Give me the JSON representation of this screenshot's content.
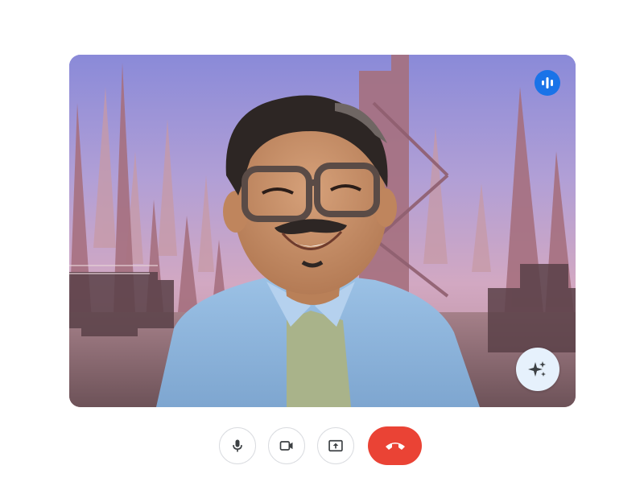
{
  "call": {
    "participant": {
      "video": "participant-video",
      "speaking": true
    },
    "effects_button": {
      "icon": "sparkle-icon",
      "color": "#e6f1fc"
    },
    "speaking_indicator": {
      "icon": "audio-bars-icon",
      "color": "#1a73e8"
    }
  },
  "controls": [
    {
      "id": "microphone",
      "icon": "microphone-icon"
    },
    {
      "id": "camera",
      "icon": "video-camera-icon"
    },
    {
      "id": "present",
      "icon": "present-screen-icon"
    },
    {
      "id": "end_call",
      "icon": "end-call-icon",
      "color": "#ea4335"
    }
  ],
  "colors": {
    "accent": "#1a73e8",
    "danger": "#ea4335",
    "control_border": "#dadce0",
    "icon": "#3c4043"
  }
}
